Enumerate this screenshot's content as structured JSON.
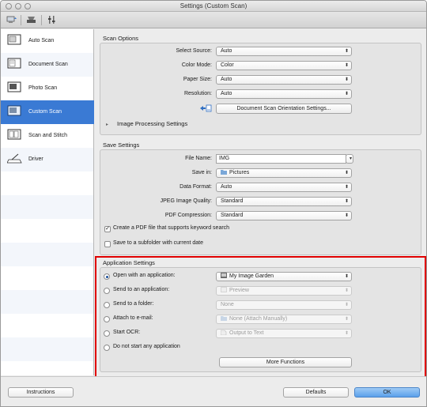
{
  "window": {
    "title": "Settings (Custom Scan)"
  },
  "toolbar": {
    "icons": [
      "scan-from-computer-icon",
      "scan-from-panel-icon",
      "general-settings-icon"
    ]
  },
  "sidebar": {
    "items": [
      {
        "label": "Auto Scan",
        "icon": "auto-scan-icon"
      },
      {
        "label": "Document Scan",
        "icon": "document-scan-icon"
      },
      {
        "label": "Photo Scan",
        "icon": "photo-scan-icon"
      },
      {
        "label": "Custom Scan",
        "icon": "custom-scan-icon",
        "selected": true
      },
      {
        "label": "Scan and Stitch",
        "icon": "scan-and-stitch-icon"
      },
      {
        "label": "Driver",
        "icon": "driver-icon"
      }
    ]
  },
  "scan_options": {
    "title": "Scan Options",
    "select_source": {
      "label": "Select Source:",
      "value": "Auto"
    },
    "color_mode": {
      "label": "Color Mode:",
      "value": "Color"
    },
    "paper_size": {
      "label": "Paper Size:",
      "value": "Auto"
    },
    "resolution": {
      "label": "Resolution:",
      "value": "Auto"
    },
    "orientation_button": "Document Scan Orientation Settings...",
    "image_processing": "Image Processing Settings"
  },
  "save_settings": {
    "title": "Save Settings",
    "file_name": {
      "label": "File Name:",
      "value": "IMG"
    },
    "save_in": {
      "label": "Save in:",
      "value": "Pictures"
    },
    "data_format": {
      "label": "Data Format:",
      "value": "Auto"
    },
    "jpeg_quality": {
      "label": "JPEG Image Quality:",
      "value": "Standard"
    },
    "pdf_compression": {
      "label": "PDF Compression:",
      "value": "Standard"
    },
    "keyword_pdf": {
      "label": "Create a PDF file that supports keyword search",
      "checked": true
    },
    "subfolder": {
      "label": "Save to a subfolder with current date",
      "checked": false
    }
  },
  "application_settings": {
    "title": "Application Settings",
    "open_with": {
      "label": "Open with an application:",
      "value": "My Image Garden",
      "selected": true
    },
    "send_to_app": {
      "label": "Send to an application:",
      "value": "Preview"
    },
    "send_to_folder": {
      "label": "Send to a folder:",
      "value": "None"
    },
    "attach_email": {
      "label": "Attach to e-mail:",
      "value": "None (Attach Manually)"
    },
    "start_ocr": {
      "label": "Start OCR:",
      "value": "Output to Text"
    },
    "no_app": {
      "label": "Do not start any application"
    },
    "more_functions": "More Functions"
  },
  "footer": {
    "instructions": "Instructions",
    "defaults": "Defaults",
    "ok": "OK"
  },
  "colors": {
    "accent": "#3a7ad4",
    "highlight": "#e00000"
  }
}
